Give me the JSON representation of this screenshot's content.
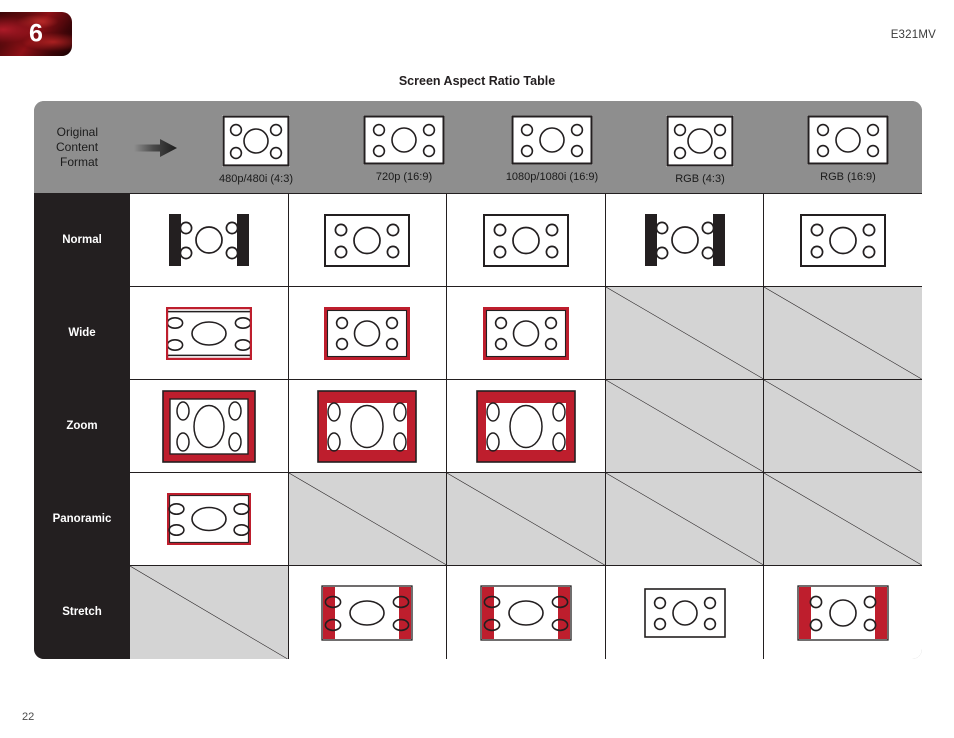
{
  "page": {
    "chapter_number": "6",
    "model_id": "E321MV",
    "page_number": "22"
  },
  "table": {
    "title": "Screen Aspect Ratio Table",
    "origin_label": "Original\nContent\nFormat",
    "arrow_icon": "right-arrow-icon",
    "colors": {
      "header_band": "#8e8e8e",
      "row_label_band": "#231f20",
      "accent_red": "#be1e2d",
      "na_fill": "#d4d4d4",
      "line": "#231f20"
    },
    "columns": [
      {
        "id": "480p",
        "label": "480p/480i (4:3)",
        "ratio": "4:3"
      },
      {
        "id": "720p",
        "label": "720p (16:9)",
        "ratio": "16:9"
      },
      {
        "id": "1080p",
        "label": "1080p/1080i (16:9)",
        "ratio": "16:9"
      },
      {
        "id": "rgb43",
        "label": "RGB (4:3)",
        "ratio": "4:3"
      },
      {
        "id": "rgb169",
        "label": "RGB (16:9)",
        "ratio": "16:9"
      }
    ],
    "rows": [
      {
        "id": "normal",
        "label": "Normal",
        "cells": [
          {
            "mode": "pillarbox",
            "available": true
          },
          {
            "mode": "full",
            "available": true
          },
          {
            "mode": "full",
            "available": true
          },
          {
            "mode": "pillarbox",
            "available": true
          },
          {
            "mode": "full",
            "available": true
          }
        ]
      },
      {
        "id": "wide",
        "label": "Wide",
        "cells": [
          {
            "mode": "wide-crop",
            "available": true
          },
          {
            "mode": "red-frame",
            "available": true
          },
          {
            "mode": "red-frame",
            "available": true
          },
          {
            "mode": "na",
            "available": false
          },
          {
            "mode": "na",
            "available": false
          }
        ]
      },
      {
        "id": "zoom",
        "label": "Zoom",
        "cells": [
          {
            "mode": "zoom-thin",
            "available": true
          },
          {
            "mode": "zoom-thick",
            "available": true
          },
          {
            "mode": "zoom-thick",
            "available": true
          },
          {
            "mode": "na",
            "available": false
          },
          {
            "mode": "na",
            "available": false
          }
        ]
      },
      {
        "id": "panoramic",
        "label": "Panoramic",
        "cells": [
          {
            "mode": "panoramic",
            "available": true
          },
          {
            "mode": "na",
            "available": false
          },
          {
            "mode": "na",
            "available": false
          },
          {
            "mode": "na",
            "available": false
          },
          {
            "mode": "na",
            "available": false
          }
        ]
      },
      {
        "id": "stretch",
        "label": "Stretch",
        "cells": [
          {
            "mode": "na",
            "available": false
          },
          {
            "mode": "stretch-bars",
            "available": true
          },
          {
            "mode": "stretch-bars",
            "available": true
          },
          {
            "mode": "plain",
            "available": true
          },
          {
            "mode": "stretch-bars",
            "available": true
          }
        ]
      }
    ]
  }
}
